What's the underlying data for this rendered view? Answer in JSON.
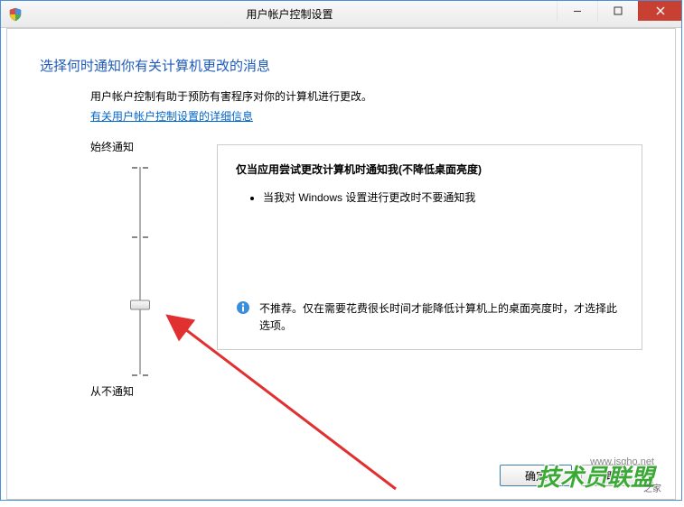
{
  "titlebar": {
    "title": "用户帐户控制设置"
  },
  "content": {
    "heading": "选择何时通知你有关计算机更改的消息",
    "description": "用户帐户控制有助于预防有害程序对你的计算机进行更改。",
    "link": "有关用户帐户控制设置的详细信息"
  },
  "slider": {
    "top_label": "始终通知",
    "bottom_label": "从不通知",
    "position": 2,
    "levels": 4
  },
  "detail": {
    "title": "仅当应用尝试更改计算机时通知我(不降低桌面亮度)",
    "bullets": [
      "当我对 Windows 设置进行更改时不要通知我"
    ],
    "note": "不推荐。仅在需要花费很长时间才能降低计算机上的桌面亮度时，才选择此选项。"
  },
  "buttons": {
    "ok": "确定",
    "cancel": "取消"
  },
  "watermark": {
    "text": "技术员联盟",
    "sub": "之家",
    "url": "www.jsgho.net"
  }
}
